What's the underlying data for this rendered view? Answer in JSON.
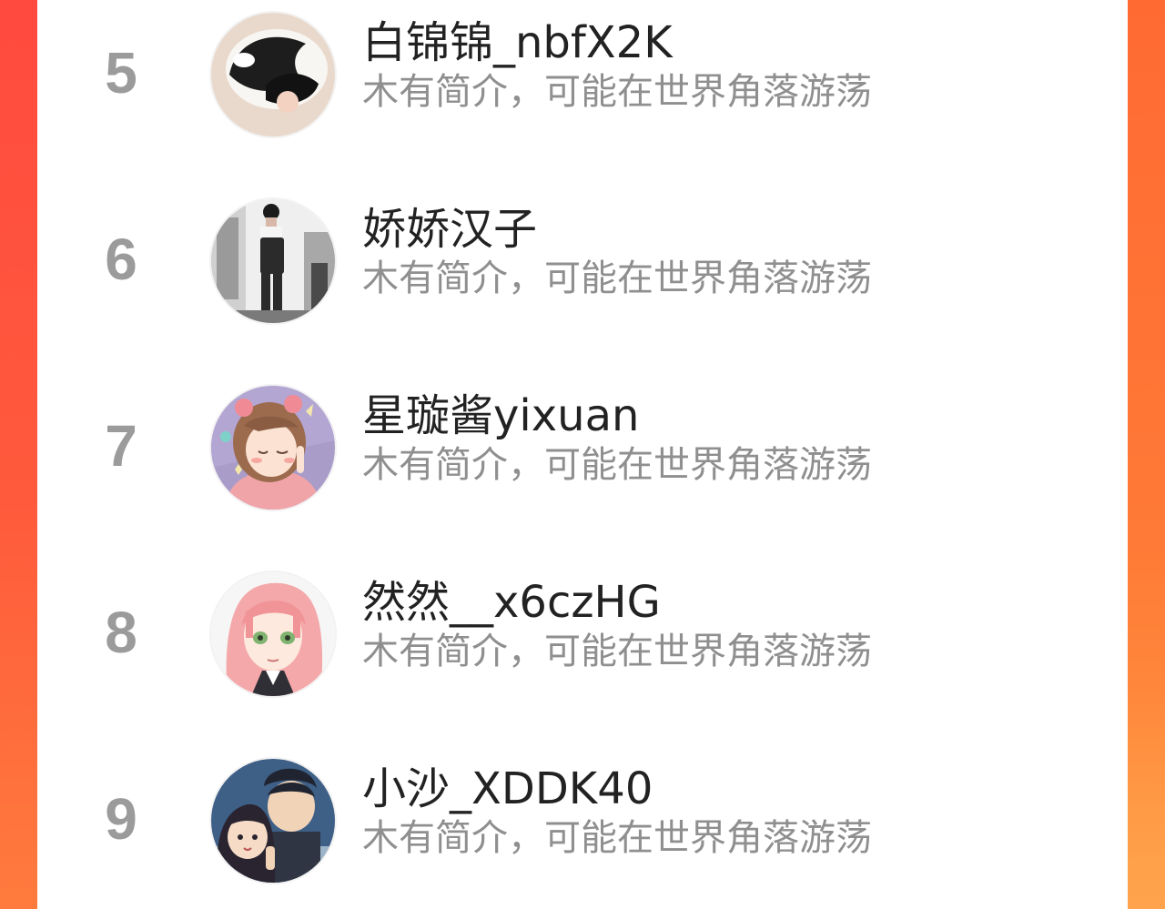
{
  "leaderboard": {
    "items": [
      {
        "rank": "5",
        "name": "白锦锦_nbfX2K",
        "bio": "木有简介，可能在世界角落游荡",
        "avatar_icon": "cat-avatar-icon"
      },
      {
        "rank": "6",
        "name": "娇娇汉子",
        "bio": "木有简介，可能在世界角落游荡",
        "avatar_icon": "girl-photo-avatar-icon"
      },
      {
        "rank": "7",
        "name": "星璇酱yixuan",
        "bio": "木有简介，可能在世界角落游荡",
        "avatar_icon": "anime-girl-avatar-icon"
      },
      {
        "rank": "8",
        "name": "然然__x6czHG",
        "bio": "木有简介，可能在世界角落游荡",
        "avatar_icon": "pink-hair-avatar-icon"
      },
      {
        "rank": "9",
        "name": "小沙_XDDK40",
        "bio": "木有简介，可能在世界角落游荡",
        "avatar_icon": "couple-avatar-icon"
      }
    ]
  },
  "colors": {
    "background_left": "#ff4a3f",
    "background_right": "#ff7a36",
    "rank_number": "#9b9b9b",
    "name_text": "#222222",
    "bio_text": "#8f8f8f"
  }
}
